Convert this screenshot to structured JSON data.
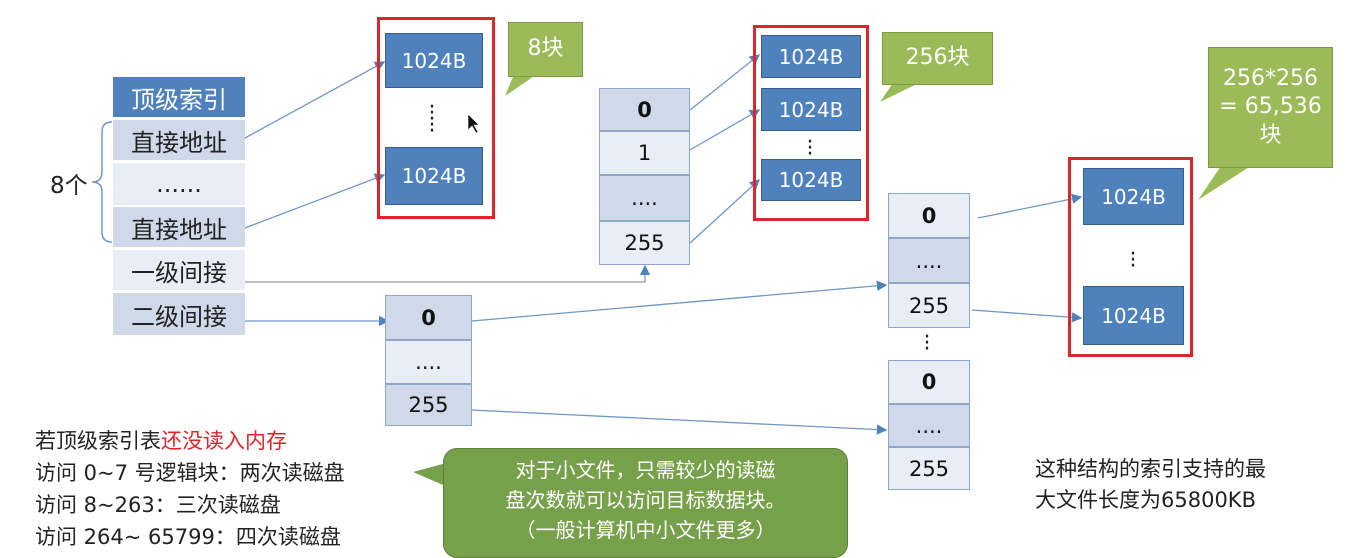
{
  "top_index": {
    "header": "顶级索引",
    "rows": [
      "直接地址",
      "......",
      "直接地址",
      "一级间接",
      "二级间接"
    ],
    "brace_label": "8个"
  },
  "direct_blocks": {
    "blocks": [
      "1024B",
      "1024B"
    ],
    "callout": "8块"
  },
  "level1_table": {
    "rows": [
      "0",
      "1",
      "....",
      "255"
    ]
  },
  "level1_blocks": {
    "blocks": [
      "1024B",
      "1024B",
      "1024B"
    ],
    "callout": "256块"
  },
  "level2_table": {
    "rows": [
      "0",
      "....",
      "255"
    ]
  },
  "level2_sub_table_a": {
    "rows": [
      "0",
      "....",
      "255"
    ]
  },
  "level2_sub_table_b": {
    "rows": [
      "0",
      "....",
      "255"
    ]
  },
  "level2_blocks": {
    "blocks": [
      "1024B",
      "1024B"
    ],
    "callout_lines": [
      "256*256",
      "= 65,536",
      "块"
    ]
  },
  "notes": {
    "line1_prefix": "若顶级索引表",
    "line1_highlight": "还没读入内存",
    "line2": "访问 0~7 号逻辑块：两次读磁盘",
    "line3": "访问 8~263：三次读磁盘",
    "line4": "访问 264~ 65799：四次读磁盘"
  },
  "small_file_callout": {
    "lines": [
      "对于小文件，只需较少的读磁",
      "盘次数就可以访问目标数据块。",
      "（一般计算机中小文件更多）"
    ]
  },
  "max_size_note": {
    "lines": [
      "这种结构的索引支持的最",
      "大文件长度为65800KB"
    ]
  },
  "colors": {
    "accent_blue": "#4f81bd",
    "highlight_red": "#e0242b",
    "callout_green": "#9bbb59",
    "note_green": "#77a04a"
  }
}
